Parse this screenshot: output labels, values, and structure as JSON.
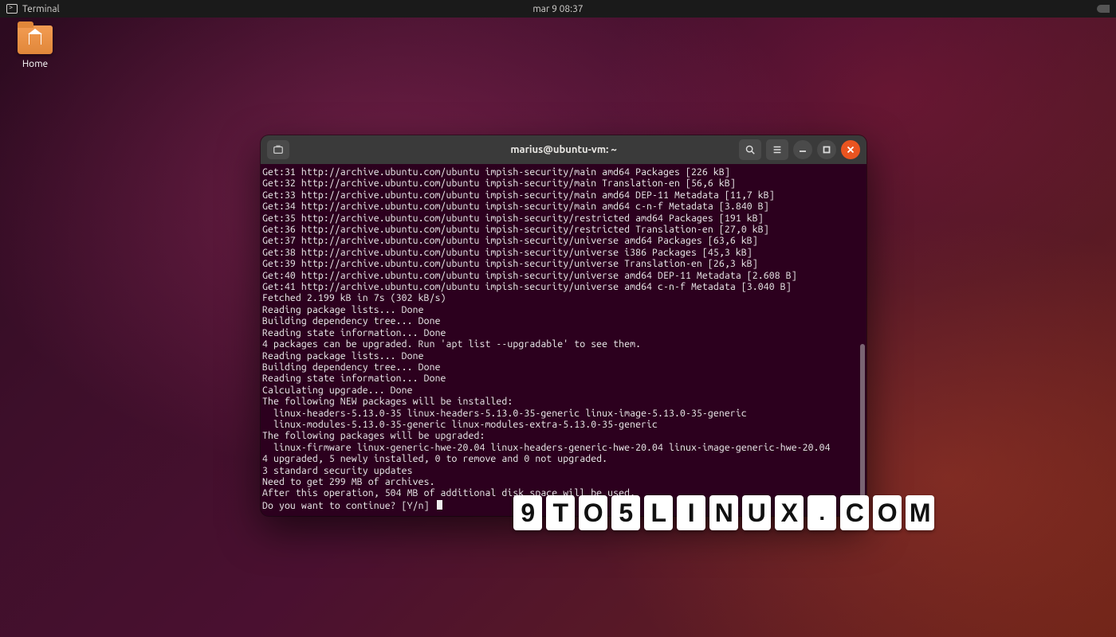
{
  "topbar": {
    "app_label": "Terminal",
    "clock": "mar 9  08:37"
  },
  "desktop": {
    "home_label": "Home"
  },
  "terminal": {
    "title": "marius@ubuntu-vm: ~",
    "lines": [
      "Get:31 http://archive.ubuntu.com/ubuntu impish-security/main amd64 Packages [226 kB]",
      "Get:32 http://archive.ubuntu.com/ubuntu impish-security/main Translation-en [56,6 kB]",
      "Get:33 http://archive.ubuntu.com/ubuntu impish-security/main amd64 DEP-11 Metadata [11,7 kB]",
      "Get:34 http://archive.ubuntu.com/ubuntu impish-security/main amd64 c-n-f Metadata [3.840 B]",
      "Get:35 http://archive.ubuntu.com/ubuntu impish-security/restricted amd64 Packages [191 kB]",
      "Get:36 http://archive.ubuntu.com/ubuntu impish-security/restricted Translation-en [27,0 kB]",
      "Get:37 http://archive.ubuntu.com/ubuntu impish-security/universe amd64 Packages [63,6 kB]",
      "Get:38 http://archive.ubuntu.com/ubuntu impish-security/universe i386 Packages [45,3 kB]",
      "Get:39 http://archive.ubuntu.com/ubuntu impish-security/universe Translation-en [26,3 kB]",
      "Get:40 http://archive.ubuntu.com/ubuntu impish-security/universe amd64 DEP-11 Metadata [2.608 B]",
      "Get:41 http://archive.ubuntu.com/ubuntu impish-security/universe amd64 c-n-f Metadata [3.040 B]",
      "Fetched 2.199 kB in 7s (302 kB/s)",
      "Reading package lists... Done",
      "Building dependency tree... Done",
      "Reading state information... Done",
      "4 packages can be upgraded. Run 'apt list --upgradable' to see them.",
      "Reading package lists... Done",
      "Building dependency tree... Done",
      "Reading state information... Done",
      "Calculating upgrade... Done",
      "The following NEW packages will be installed:",
      "  linux-headers-5.13.0-35 linux-headers-5.13.0-35-generic linux-image-5.13.0-35-generic",
      "  linux-modules-5.13.0-35-generic linux-modules-extra-5.13.0-35-generic",
      "The following packages will be upgraded:",
      "  linux-firmware linux-generic-hwe-20.04 linux-headers-generic-hwe-20.04 linux-image-generic-hwe-20.04",
      "4 upgraded, 5 newly installed, 0 to remove and 0 not upgraded.",
      "3 standard security updates",
      "Need to get 299 MB of archives.",
      "After this operation, 504 MB of additional disk space will be used."
    ],
    "prompt": "Do you want to continue? [Y/n] "
  },
  "watermark": {
    "chars": [
      "9",
      "T",
      "O",
      "5",
      "L",
      "I",
      "N",
      "U",
      "X",
      ".",
      "C",
      "O",
      "M"
    ]
  }
}
